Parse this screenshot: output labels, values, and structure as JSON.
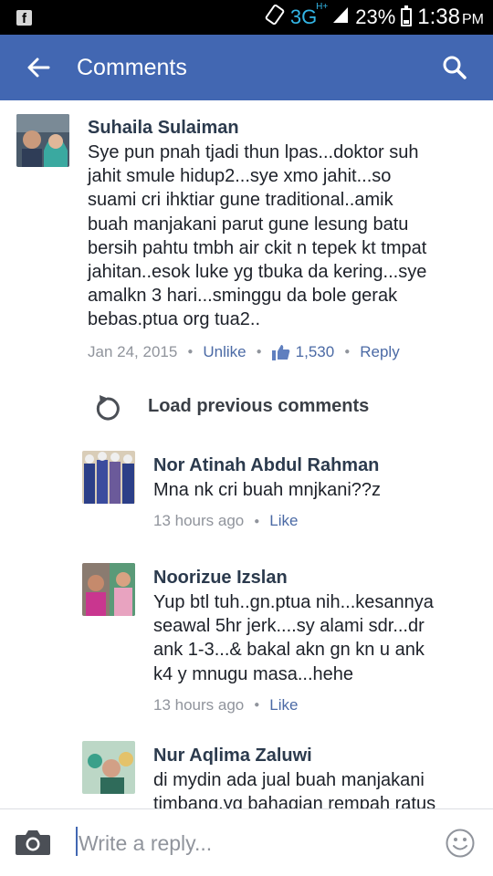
{
  "status_bar": {
    "network": "3G",
    "network_sup": "H+",
    "battery": "23%",
    "time": "1:38",
    "ampm": "PM"
  },
  "header": {
    "title": "Comments"
  },
  "load_previous": "Load previous comments",
  "comments": [
    {
      "name": "Suhaila Sulaiman",
      "text_lines": [
        "Sye pun pnah tjadi thun lpas...doktor suh",
        "jahit smule hidup2...sye xmo jahit...so",
        "suami cri ihktiar gune traditional..amik",
        "buah manjakani parut gune lesung batu",
        "bersih pahtu tmbh air ckit n tepek kt tmpat",
        "jahitan..esok luke yg tbuka da kering...sye",
        "amalkn 3 hari...sminggu da bole gerak",
        "bebas.ptua org tua2.."
      ],
      "time": "Jan 24, 2015",
      "like_label": "Unlike",
      "like_count": "1,530",
      "reply_label": "Reply"
    },
    {
      "name": "Nor Atinah Abdul Rahman",
      "text_lines": [
        "Mna nk cri buah mnjkani??z"
      ],
      "time": "13 hours ago",
      "like_label": "Like"
    },
    {
      "name": "Noorizue Izslan",
      "text_lines": [
        "Yup btl tuh..gn.ptua nih...kesannya",
        "seawal 5hr jerk....sy alami sdr...dr",
        "ank 1-3...& bakal akn gn kn u ank",
        "k4 y mnugu masa...hehe"
      ],
      "time": "13 hours ago",
      "like_label": "Like"
    },
    {
      "name": "Nur Aqlima Zaluwi",
      "text_lines": [
        "di mydin ada jual buah manjakani",
        "timbang.yg bahagian rempah ratus"
      ]
    }
  ],
  "reply_bar": {
    "placeholder": "Write a reply..."
  },
  "colors": {
    "header_bg": "#4267b2",
    "link": "#4b6aa5",
    "meta": "#90949c"
  }
}
